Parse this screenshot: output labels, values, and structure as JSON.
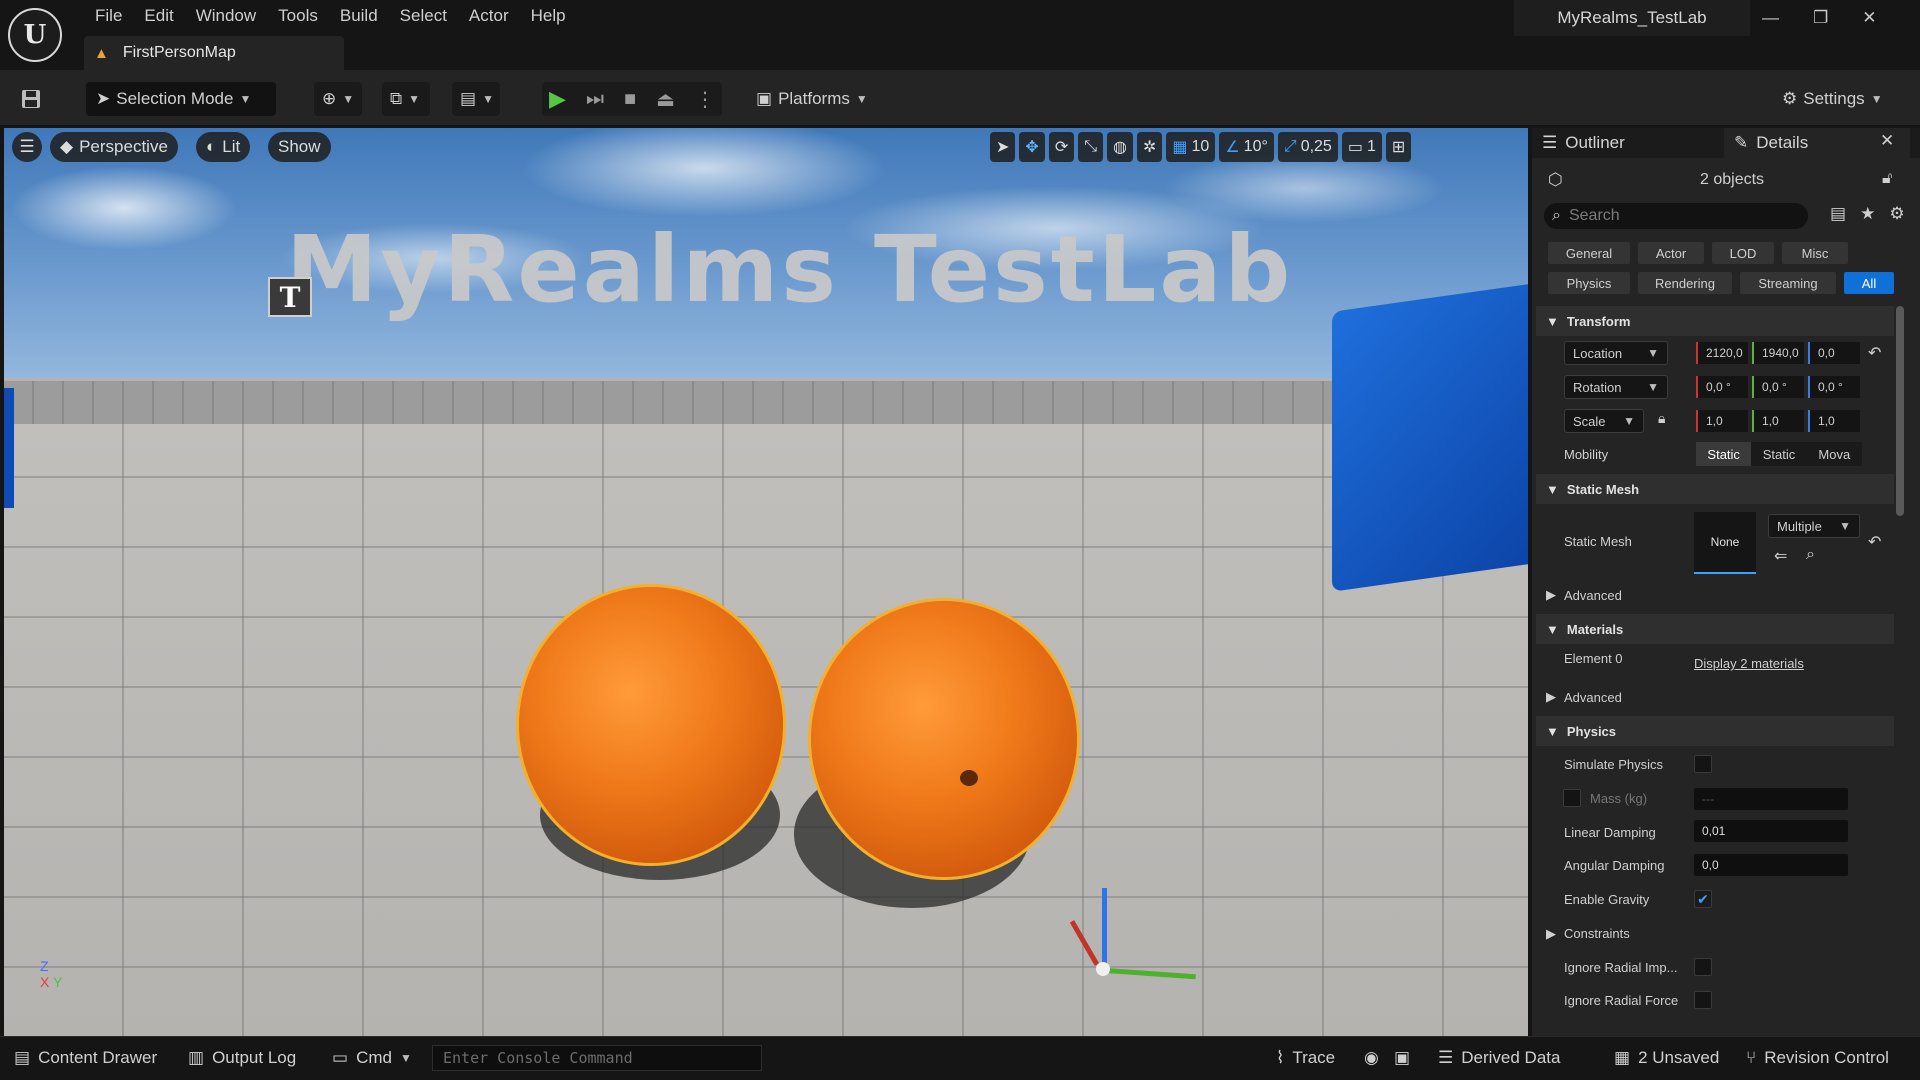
{
  "menu": [
    "File",
    "Edit",
    "Window",
    "Tools",
    "Build",
    "Select",
    "Actor",
    "Help"
  ],
  "map_tab": "FirstPersonMap",
  "project_title": "MyRealms_TestLab",
  "toolbar": {
    "selection_mode": "Selection Mode",
    "platforms": "Platforms",
    "settings": "Settings"
  },
  "viewport": {
    "perspective": "Perspective",
    "lit": "Lit",
    "show": "Show",
    "grid_snap": "10",
    "rotation_snap": "10°",
    "scale_snap": "0,25",
    "camera_speed": "1",
    "world_text": "MyRealms TestLab",
    "axis_z": "Z",
    "axis_x": "X",
    "axis_y": "Y"
  },
  "panel": {
    "tab_outliner": "Outliner",
    "tab_details": "Details",
    "objects_count": "2 objects",
    "search_placeholder": "Search",
    "filters_row1": [
      "General",
      "Actor",
      "LOD",
      "Misc"
    ],
    "filters_row2": [
      "Physics",
      "Rendering",
      "Streaming",
      "All"
    ],
    "selected_filter": "All",
    "transform": {
      "header": "Transform",
      "location_label": "Location",
      "location": [
        "2120,0",
        "1940,0",
        "0,0"
      ],
      "rotation_label": "Rotation",
      "rotation": [
        "0,0 °",
        "0,0 °",
        "0,0 °"
      ],
      "scale_label": "Scale",
      "scale": [
        "1,0",
        "1,0",
        "1,0"
      ],
      "mobility_label": "Mobility",
      "mobility_options": [
        "Static",
        "Static",
        "Mova"
      ]
    },
    "static_mesh": {
      "header": "Static Mesh",
      "label": "Static Mesh",
      "thumb": "None",
      "value": "Multiple",
      "advanced": "Advanced"
    },
    "materials": {
      "header": "Materials",
      "element0": "Element 0",
      "link": "Display 2 materials",
      "advanced": "Advanced"
    },
    "physics": {
      "header": "Physics",
      "simulate": "Simulate Physics",
      "mass": "Mass (kg)",
      "mass_value": "---",
      "linear_damping": "Linear Damping",
      "linear_damping_value": "0,01",
      "angular_damping": "Angular Damping",
      "angular_damping_value": "0,0",
      "enable_gravity": "Enable Gravity",
      "constraints": "Constraints",
      "ignore_radial_impulse": "Ignore Radial Imp...",
      "ignore_radial_force": "Ignore Radial Force"
    }
  },
  "statusbar": {
    "content_drawer": "Content Drawer",
    "output_log": "Output Log",
    "cmd": "Cmd",
    "console_placeholder": "Enter Console Command",
    "trace": "Trace",
    "derived_data": "Derived Data",
    "unsaved": "2 Unsaved",
    "revision_control": "Revision Control"
  }
}
